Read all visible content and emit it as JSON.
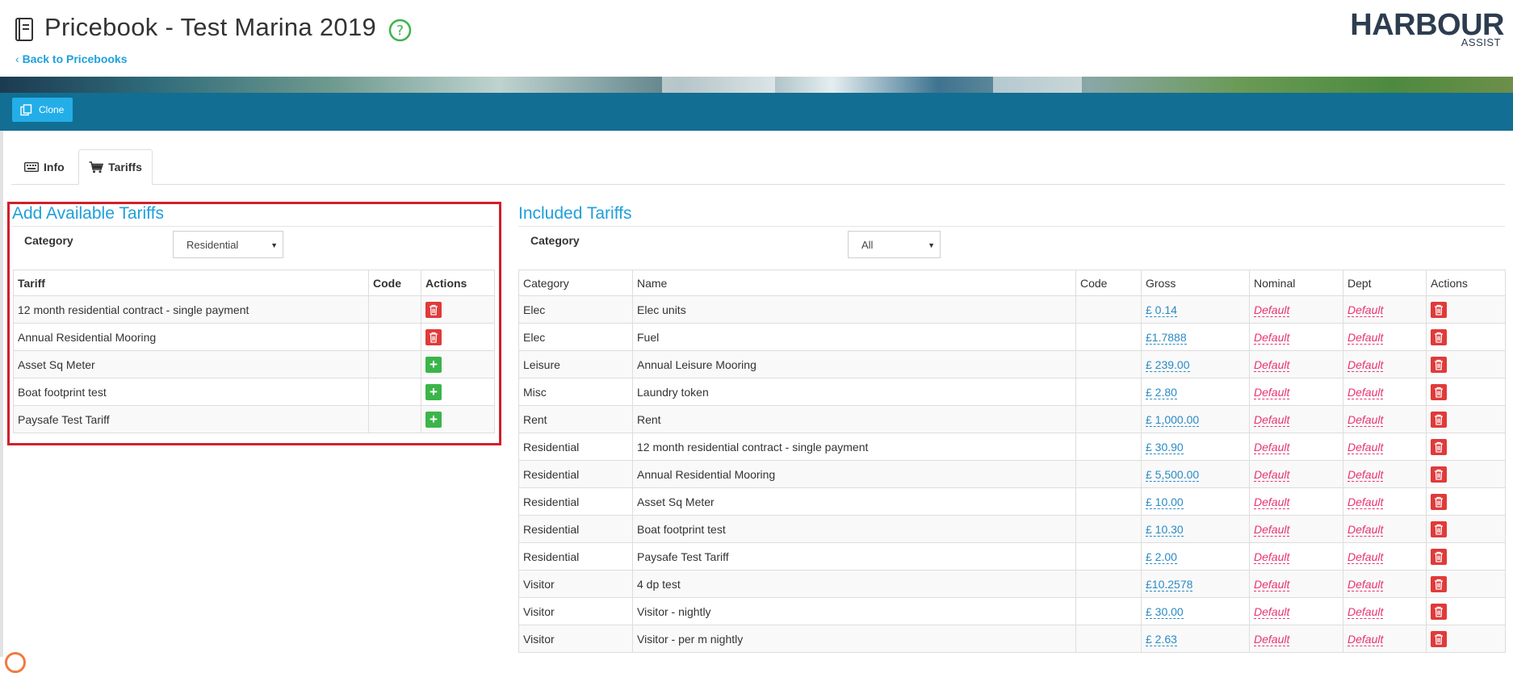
{
  "header": {
    "title": "Pricebook - Test Marina 2019",
    "back_link": "Back to Pricebooks",
    "logo_main": "HARBOUR",
    "logo_sub": "ASSIST"
  },
  "toolbar": {
    "clone_label": "Clone"
  },
  "tabs": [
    {
      "label": "Info",
      "icon": "keyboard-icon",
      "active": false
    },
    {
      "label": "Tariffs",
      "icon": "cart-icon",
      "active": true
    }
  ],
  "available": {
    "title": "Add Available Tariffs",
    "category_label": "Category",
    "category_value": "Residential",
    "columns": [
      "Tariff",
      "Code",
      "Actions"
    ],
    "rows": [
      {
        "tariff": "12 month residential contract - single payment",
        "code": "",
        "action": "delete"
      },
      {
        "tariff": "Annual Residential Mooring",
        "code": "",
        "action": "delete"
      },
      {
        "tariff": "Asset Sq Meter",
        "code": "",
        "action": "add"
      },
      {
        "tariff": "Boat footprint test",
        "code": "",
        "action": "add"
      },
      {
        "tariff": "Paysafe Test Tariff",
        "code": "",
        "action": "add"
      }
    ]
  },
  "included": {
    "title": "Included Tariffs",
    "category_label": "Category",
    "category_value": "All",
    "columns": [
      "Category",
      "Name",
      "Code",
      "Gross",
      "Nominal",
      "Dept",
      "Actions"
    ],
    "rows": [
      {
        "category": "Elec",
        "name": "Elec units",
        "code": "",
        "gross": "£ 0.14",
        "nominal": "Default",
        "dept": "Default"
      },
      {
        "category": "Elec",
        "name": "Fuel",
        "code": "",
        "gross": "£1.7888",
        "nominal": "Default",
        "dept": "Default"
      },
      {
        "category": "Leisure",
        "name": "Annual Leisure Mooring",
        "code": "",
        "gross": "£ 239.00",
        "nominal": "Default",
        "dept": "Default"
      },
      {
        "category": "Misc",
        "name": "Laundry token",
        "code": "",
        "gross": "£ 2.80",
        "nominal": "Default",
        "dept": "Default"
      },
      {
        "category": "Rent",
        "name": "Rent",
        "code": "",
        "gross": "£ 1,000.00",
        "nominal": "Default",
        "dept": "Default"
      },
      {
        "category": "Residential",
        "name": "12 month residential contract - single payment",
        "code": "",
        "gross": "£ 30.90",
        "nominal": "Default",
        "dept": "Default"
      },
      {
        "category": "Residential",
        "name": "Annual Residential Mooring",
        "code": "",
        "gross": "£ 5,500.00",
        "nominal": "Default",
        "dept": "Default"
      },
      {
        "category": "Residential",
        "name": "Asset Sq Meter",
        "code": "",
        "gross": "£ 10.00",
        "nominal": "Default",
        "dept": "Default"
      },
      {
        "category": "Residential",
        "name": "Boat footprint test",
        "code": "",
        "gross": "£ 10.30",
        "nominal": "Default",
        "dept": "Default"
      },
      {
        "category": "Residential",
        "name": "Paysafe Test Tariff",
        "code": "",
        "gross": "£ 2.00",
        "nominal": "Default",
        "dept": "Default"
      },
      {
        "category": "Visitor",
        "name": "4 dp test",
        "code": "",
        "gross": "£10.2578",
        "nominal": "Default",
        "dept": "Default"
      },
      {
        "category": "Visitor",
        "name": "Visitor - nightly",
        "code": "",
        "gross": "£ 30.00",
        "nominal": "Default",
        "dept": "Default"
      },
      {
        "category": "Visitor",
        "name": "Visitor - per m nightly",
        "code": "",
        "gross": "£ 2.63",
        "nominal": "Default",
        "dept": "Default"
      }
    ]
  },
  "colors": {
    "accent": "#1ea0dc",
    "toolbar": "#126e93",
    "clone_button": "#23aee8",
    "delete": "#e03a3a",
    "add": "#3bb54a",
    "default_link": "#e8336d",
    "highlight": "#d0202b"
  }
}
